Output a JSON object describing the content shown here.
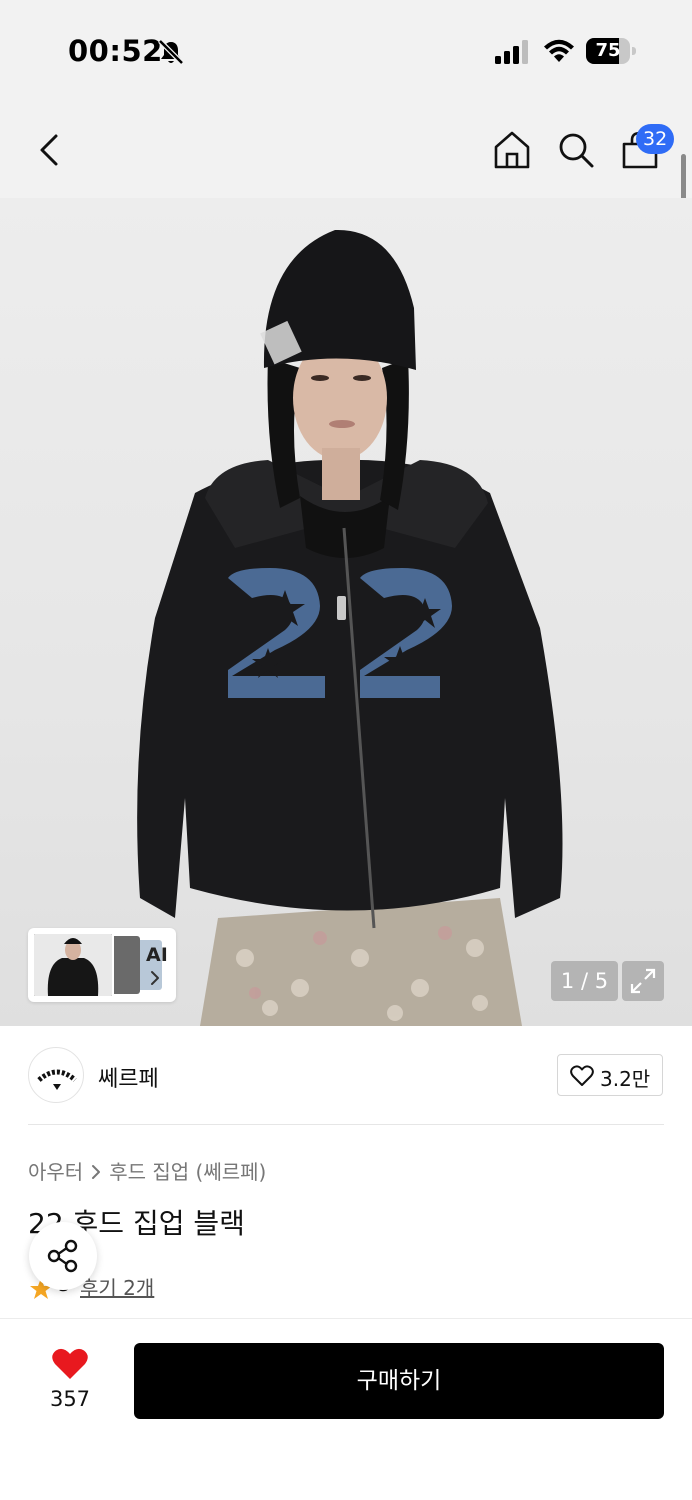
{
  "status_bar": {
    "time": "00:52",
    "battery_level": "75",
    "battery_fraction": 0.75
  },
  "nav": {
    "cart_count": "32"
  },
  "gallery": {
    "ai_label": "AI",
    "page_indicator": "1 / 5"
  },
  "brand": {
    "name": "쎄르페",
    "like_count": "3.2만"
  },
  "product": {
    "breadcrumb": [
      "아우터",
      "후드 집업 (쎄르페)"
    ],
    "title": "22 후드 집업 블랙",
    "rating": "5",
    "review_link": "후기 2개"
  },
  "bottom_bar": {
    "wish_count": "357",
    "buy_label": "구매하기"
  },
  "colors": {
    "badge_blue": "#2f6cf6",
    "heart_red": "#e8191f",
    "star_orange": "#f5a623"
  }
}
